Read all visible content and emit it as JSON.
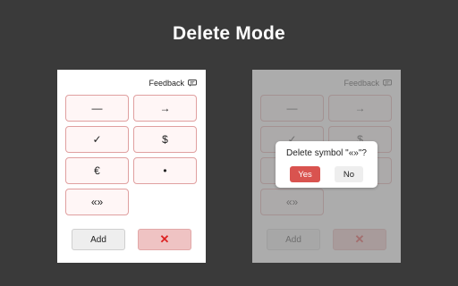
{
  "page_title": "Delete Mode",
  "colors": {
    "background": "#3a3a3a",
    "symbol_border": "#e0a0a0",
    "cancel_fill": "#efc3c3",
    "yes_fill": "#d9534f"
  },
  "panels": {
    "feedback_label": "Feedback",
    "feedback_icon": "chat-bubble-icon",
    "symbols": [
      "—",
      "→",
      "✓",
      "$",
      "€",
      "•",
      "«»"
    ],
    "add_label": "Add",
    "cancel_label": "✕",
    "cancel_icon": "close-icon"
  },
  "dialog": {
    "message": "Delete symbol \"«»\"?",
    "yes_label": "Yes",
    "no_label": "No"
  }
}
